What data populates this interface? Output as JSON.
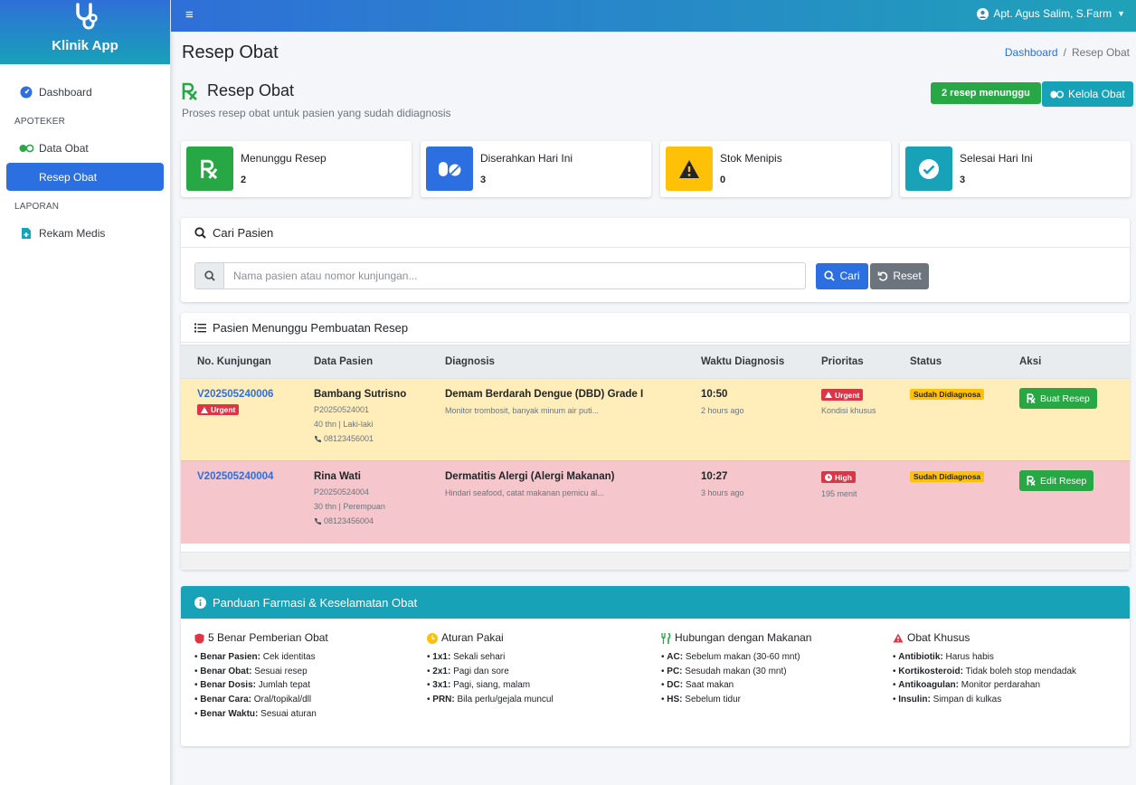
{
  "brand": {
    "name": "Klinik App"
  },
  "sidebar": {
    "items": [
      {
        "label": "Dashboard"
      },
      {
        "header": "APOTEKER"
      },
      {
        "label": "Data Obat"
      },
      {
        "label": "Resep Obat"
      },
      {
        "header": "LAPORAN"
      },
      {
        "label": "Rekam Medis"
      }
    ]
  },
  "topbar": {
    "user": "Apt. Agus Salim, S.Farm"
  },
  "page": {
    "title": "Resep Obat",
    "breadcrumb": {
      "home": "Dashboard",
      "current": "Resep Obat"
    },
    "heading": "Resep Obat",
    "subtitle": "Proses resep obat untuk pasien yang sudah didiagnosis",
    "waiting_badge": "2 resep menunggu",
    "manage_button": "Kelola Obat"
  },
  "stats": [
    {
      "label": "Menunggu Resep",
      "value": "2",
      "color": "#28a745"
    },
    {
      "label": "Diserahkan Hari Ini",
      "value": "3",
      "color": "#2c6fe0"
    },
    {
      "label": "Stok Menipis",
      "value": "0",
      "color": "#ffc107"
    },
    {
      "label": "Selesai Hari Ini",
      "value": "3",
      "color": "#17a2b8"
    }
  ],
  "search": {
    "title": "Cari Pasien",
    "placeholder": "Nama pasien atau nomor kunjungan...",
    "value": "",
    "search_button": "Cari",
    "reset_button": "Reset"
  },
  "queue": {
    "title": "Pasien Menunggu Pembuatan Resep",
    "columns": [
      "No. Kunjungan",
      "Data Pasien",
      "Diagnosis",
      "Waktu Diagnosis",
      "Prioritas",
      "Status",
      "Aksi"
    ],
    "rows": [
      {
        "visit_no": "V202505240006",
        "visit_tag": "Urgent",
        "name": "Bambang Sutrisno",
        "patient_id": "P20250524001",
        "age_gender": "40 thn | Laki-laki",
        "phone": "08123456001",
        "diagnosis": "Demam Berdarah Dengue (DBD) Grade I",
        "note": "Monitor trombosit, banyak minum air puti...",
        "time": "10:50",
        "ago": "2 hours ago",
        "priority": "Urgent",
        "priority_note": "Kondisi khusus",
        "status": "Sudah Didiagnosa",
        "action": "Buat Resep"
      },
      {
        "visit_no": "V202505240004",
        "name": "Rina Wati",
        "patient_id": "P20250524004",
        "age_gender": "30 thn | Perempuan",
        "phone": "08123456004",
        "diagnosis": "Dermatitis Alergi (Alergi Makanan)",
        "note": "Hindari seafood, catat makanan pemicu al...",
        "time": "10:27",
        "ago": "3 hours ago",
        "priority": "High",
        "priority_note": "195 menit",
        "status": "Sudah Didiagnosa",
        "action": "Edit Resep"
      }
    ]
  },
  "guide": {
    "title": "Panduan Farmasi & Keselamatan Obat",
    "columns": [
      {
        "title": "5 Benar Pemberian Obat",
        "items": [
          {
            "k": "Benar Pasien:",
            "v": "Cek identitas"
          },
          {
            "k": "Benar Obat:",
            "v": "Sesuai resep"
          },
          {
            "k": "Benar Dosis:",
            "v": "Jumlah tepat"
          },
          {
            "k": "Benar Cara:",
            "v": "Oral/topikal/dll"
          },
          {
            "k": "Benar Waktu:",
            "v": "Sesuai aturan"
          }
        ]
      },
      {
        "title": "Aturan Pakai",
        "items": [
          {
            "k": "1x1:",
            "v": "Sekali sehari"
          },
          {
            "k": "2x1:",
            "v": "Pagi dan sore"
          },
          {
            "k": "3x1:",
            "v": "Pagi, siang, malam"
          },
          {
            "k": "PRN:",
            "v": "Bila perlu/gejala muncul"
          }
        ]
      },
      {
        "title": "Hubungan dengan Makanan",
        "items": [
          {
            "k": "AC:",
            "v": "Sebelum makan (30-60 mnt)"
          },
          {
            "k": "PC:",
            "v": "Sesudah makan (30 mnt)"
          },
          {
            "k": "DC:",
            "v": "Saat makan"
          },
          {
            "k": "HS:",
            "v": "Sebelum tidur"
          }
        ]
      },
      {
        "title": "Obat Khusus",
        "items": [
          {
            "k": "Antibiotik:",
            "v": "Harus habis"
          },
          {
            "k": "Kortikosteroid:",
            "v": "Tidak boleh stop mendadak"
          },
          {
            "k": "Antikoagulan:",
            "v": "Monitor perdarahan"
          },
          {
            "k": "Insulin:",
            "v": "Simpan di kulkas"
          }
        ]
      }
    ]
  }
}
